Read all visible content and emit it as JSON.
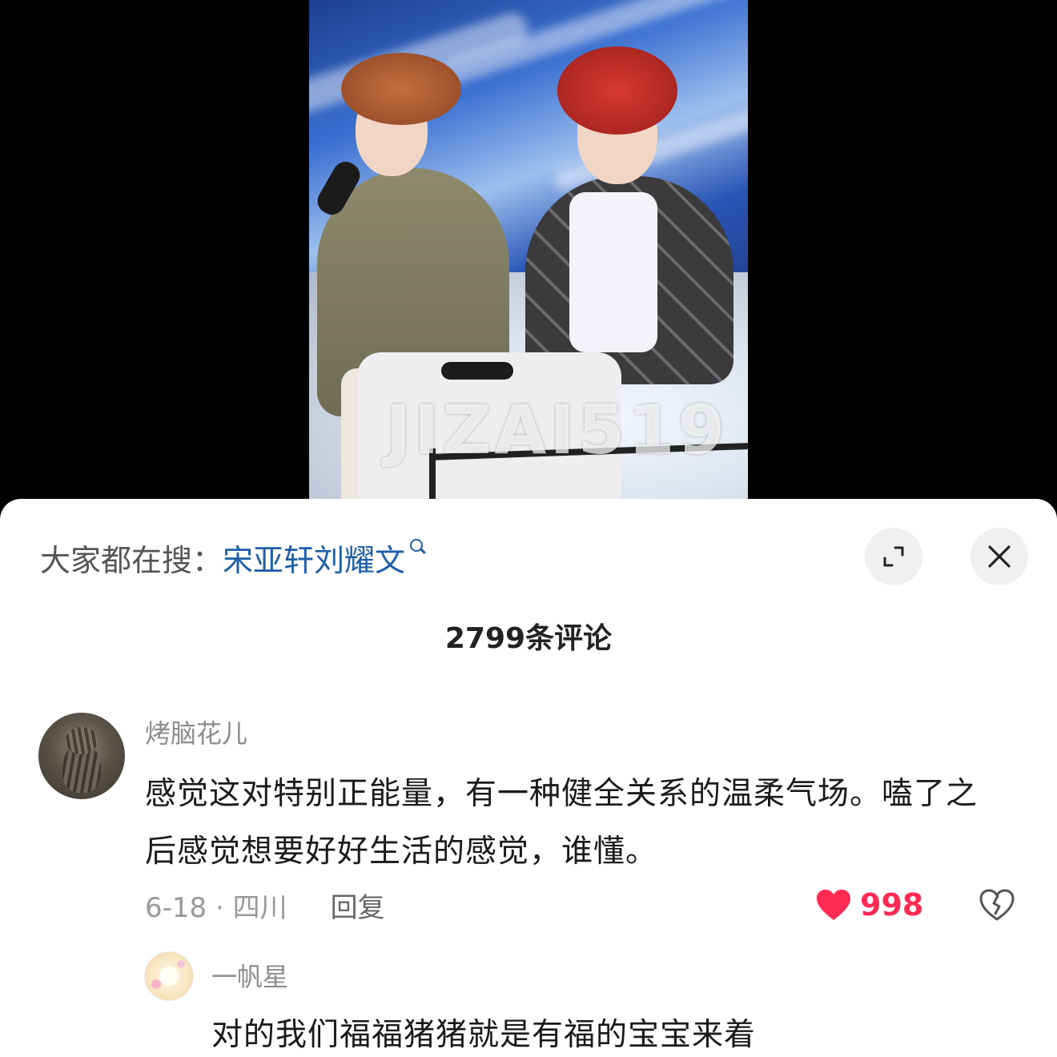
{
  "photo": {
    "watermark": "JIZAI519"
  },
  "sheet": {
    "search_prefix": "大家都在搜：",
    "search_term": "宋亚轩刘耀文",
    "comment_count": "2799条评论"
  },
  "comment": {
    "username": "烤脑花儿",
    "text": "感觉这对特别正能量，有一种健全关系的温柔气场。嗑了之后感觉想要好好生活的感觉，谁懂。",
    "date_location": "6-18 · 四川",
    "reply_label": "回复",
    "like_count": "998"
  },
  "reply": {
    "username": "一帆星",
    "text": "对的我们福福猪猪就是有福的宝宝来着"
  },
  "icons": {
    "search": "search-icon",
    "expand": "expand-icon",
    "close": "close-icon",
    "like": "heart-icon",
    "dislike": "broken-heart-icon"
  },
  "colors": {
    "search_term": "#1f5fa8",
    "like": "#fe2c55",
    "muted_text": "#8c8c8c"
  }
}
